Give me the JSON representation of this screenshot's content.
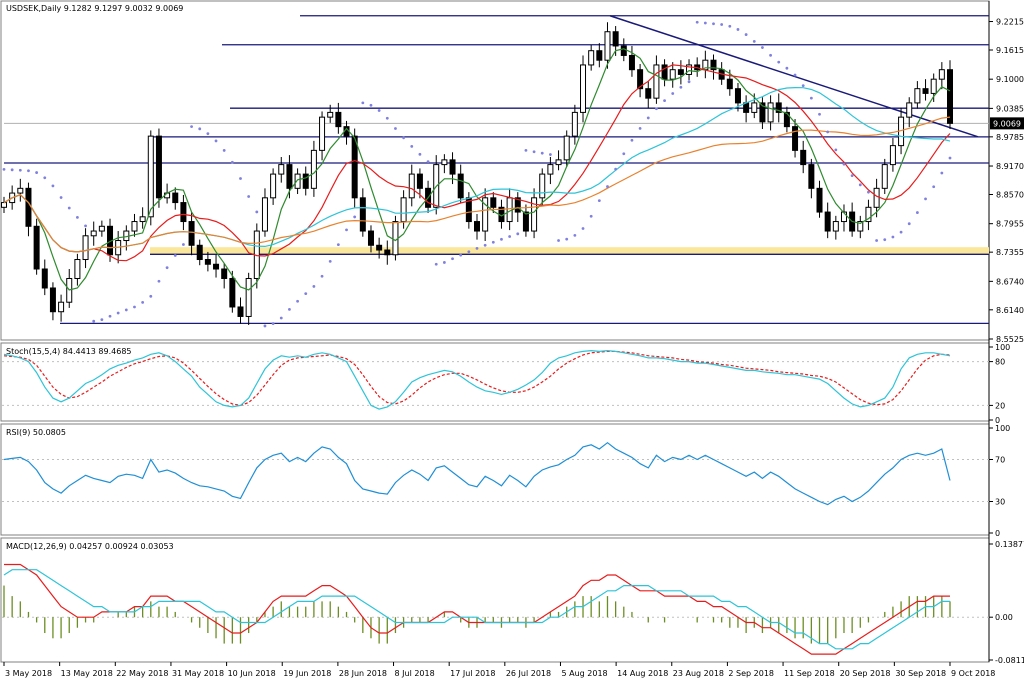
{
  "window": {
    "title": "USDSEK,Daily  9.1282 9.1297 9.0032 9.0069"
  },
  "colors": {
    "background": "#ffffff",
    "grid": "#c8c8c8",
    "candle": "#000000",
    "ma_fast": "#2e8b2e",
    "ma_mid": "#e81c1c",
    "ma_slow": "#2ec4d8",
    "ma_long": "#e8822e",
    "psar": "#8080e0",
    "hline": "#1a1a7a",
    "zone": "#fbe79a",
    "price_box": "#000000",
    "osc_main": "#1f8fd6",
    "osc_signal": "#e81c1c",
    "macd_hist": "#6b8e23"
  },
  "chart_data": [
    {
      "type": "candlestick",
      "symbol": "USDSEK",
      "timeframe": "Daily",
      "title": "USDSEK,Daily  9.1282 9.1297 9.0032 9.0069",
      "ohlc_last": {
        "open": 9.1282,
        "high": 9.1297,
        "low": 9.0032,
        "close": 9.0069
      },
      "current_price_label": "9.0069",
      "y_ticks": [
        "9.2215",
        "9.1615",
        "9.1000",
        "9.0385",
        "8.9785",
        "8.9170",
        "8.8570",
        "8.7955",
        "8.7355",
        "8.6740",
        "8.6140",
        "8.5525"
      ],
      "ylim": [
        8.5525,
        9.25
      ],
      "x_ticks": [
        "3 May 2018",
        "13 May 2018",
        "22 May 2018",
        "31 May 2018",
        "10 Jun 2018",
        "19 Jun 2018",
        "28 Jun 2018",
        "8 Jul 2018",
        "17 Jul 2018",
        "26 Jul 2018",
        "5 Aug 2018",
        "14 Aug 2018",
        "23 Aug 2018",
        "2 Sep 2018",
        "11 Sep 2018",
        "20 Sep 2018",
        "30 Sep 2018",
        "9 Oct 2018"
      ],
      "closes": [
        8.84,
        8.86,
        8.87,
        8.79,
        8.7,
        8.66,
        8.61,
        8.63,
        8.68,
        8.72,
        8.77,
        8.78,
        8.79,
        8.73,
        8.76,
        8.78,
        8.8,
        8.81,
        8.98,
        8.85,
        8.86,
        8.84,
        8.8,
        8.75,
        8.72,
        8.71,
        8.7,
        8.68,
        8.62,
        8.6,
        8.68,
        8.78,
        8.85,
        8.9,
        8.92,
        8.87,
        8.9,
        8.87,
        8.95,
        9.02,
        9.03,
        9.0,
        8.98,
        8.85,
        8.78,
        8.75,
        8.74,
        8.73,
        8.8,
        8.85,
        8.9,
        8.87,
        8.83,
        8.92,
        8.93,
        8.9,
        8.85,
        8.8,
        8.78,
        8.85,
        8.83,
        8.8,
        8.85,
        8.82,
        8.78,
        8.85,
        8.9,
        8.92,
        8.93,
        8.98,
        9.03,
        9.13,
        9.16,
        9.14,
        9.2,
        9.17,
        9.15,
        9.12,
        9.08,
        9.06,
        9.13,
        9.1,
        9.12,
        9.11,
        9.13,
        9.12,
        9.14,
        9.12,
        9.1,
        9.08,
        9.05,
        9.03,
        9.05,
        9.01,
        9.05,
        9.03,
        9.0,
        8.95,
        8.92,
        8.87,
        8.82,
        8.78,
        8.8,
        8.82,
        8.78,
        8.8,
        8.83,
        8.87,
        8.92,
        8.96,
        9.02,
        9.05,
        9.08,
        9.07,
        9.1,
        9.12,
        9.0069
      ],
      "horizontal_levels": [
        9.2337,
        9.1726,
        9.0389,
        8.9785,
        8.9233,
        8.731,
        8.5855
      ],
      "support_zone": [
        8.731,
        8.746
      ],
      "trendline": {
        "from": [
          9.2337
        ],
        "to": [
          8.9785
        ]
      }
    },
    {
      "type": "line",
      "title": "Stoch(15,5,4) 84.4413 89.4685",
      "y_ticks": [
        "100",
        "80",
        "20",
        "0"
      ],
      "ylim": [
        0,
        100
      ],
      "series": [
        {
          "name": "Stoch main",
          "values": [
            90,
            88,
            85,
            80,
            65,
            45,
            30,
            25,
            30,
            40,
            50,
            55,
            62,
            70,
            75,
            78,
            82,
            85,
            90,
            92,
            88,
            80,
            70,
            60,
            45,
            35,
            25,
            20,
            18,
            20,
            30,
            50,
            70,
            82,
            88,
            86,
            88,
            86,
            90,
            92,
            90,
            85,
            80,
            60,
            40,
            20,
            15,
            18,
            25,
            38,
            52,
            58,
            62,
            65,
            68,
            66,
            60,
            52,
            45,
            40,
            38,
            35,
            38,
            42,
            48,
            55,
            65,
            78,
            85,
            88,
            92,
            94,
            95,
            94,
            95,
            94,
            92,
            90,
            88,
            85,
            85,
            84,
            82,
            80,
            80,
            78,
            78,
            76,
            74,
            72,
            70,
            68,
            68,
            66,
            65,
            64,
            62,
            62,
            60,
            58,
            56,
            50,
            40,
            30,
            22,
            18,
            20,
            25,
            30,
            45,
            70,
            85,
            90,
            92,
            92,
            90,
            88
          ]
        },
        {
          "name": "Stoch signal",
          "values": [
            88,
            87,
            86,
            83,
            75,
            60,
            45,
            35,
            30,
            32,
            38,
            45,
            52,
            60,
            66,
            72,
            77,
            80,
            84,
            87,
            88,
            85,
            78,
            68,
            57,
            46,
            36,
            28,
            22,
            20,
            24,
            34,
            48,
            62,
            75,
            82,
            85,
            86,
            87,
            88,
            89,
            87,
            84,
            76,
            62,
            46,
            32,
            24,
            22,
            26,
            34,
            44,
            52,
            58,
            62,
            64,
            64,
            60,
            55,
            49,
            44,
            40,
            38,
            38,
            40,
            45,
            52,
            60,
            70,
            78,
            84,
            89,
            92,
            93,
            94,
            94,
            93,
            92,
            90,
            88,
            87,
            86,
            85,
            83,
            82,
            80,
            79,
            78,
            76,
            75,
            73,
            71,
            70,
            69,
            68,
            66,
            65,
            64,
            63,
            61,
            60,
            57,
            52,
            44,
            36,
            28,
            23,
            21,
            22,
            28,
            40,
            55,
            70,
            82,
            88,
            90,
            89
          ]
        }
      ]
    },
    {
      "type": "line",
      "title": "RSI(9) 50.0805",
      "y_ticks": [
        "100",
        "70",
        "30",
        "0"
      ],
      "ylim": [
        0,
        100
      ],
      "series": [
        {
          "name": "RSI",
          "values": [
            70,
            71,
            72,
            68,
            60,
            48,
            42,
            38,
            45,
            50,
            55,
            52,
            50,
            48,
            54,
            56,
            55,
            52,
            70,
            58,
            60,
            57,
            52,
            48,
            45,
            44,
            42,
            40,
            35,
            33,
            48,
            62,
            70,
            74,
            76,
            68,
            72,
            68,
            76,
            82,
            80,
            72,
            66,
            50,
            42,
            40,
            38,
            37,
            48,
            55,
            60,
            56,
            50,
            62,
            64,
            58,
            52,
            46,
            44,
            54,
            50,
            45,
            55,
            50,
            44,
            54,
            60,
            63,
            65,
            70,
            74,
            82,
            84,
            80,
            86,
            80,
            76,
            72,
            66,
            62,
            74,
            68,
            72,
            70,
            74,
            70,
            74,
            70,
            66,
            62,
            58,
            54,
            58,
            52,
            58,
            54,
            48,
            42,
            38,
            34,
            30,
            27,
            32,
            35,
            30,
            34,
            40,
            48,
            56,
            62,
            70,
            74,
            76,
            74,
            76,
            80,
            50
          ]
        }
      ]
    },
    {
      "type": "bar",
      "title": "MACD(12,26,9) 0.04257 0.00924 0.03053",
      "y_ticks": [
        "0.13877",
        "0.00",
        "-0.08114"
      ],
      "ylim": [
        -0.08114,
        0.13877
      ],
      "series": [
        {
          "name": "MACD histogram",
          "values": [
            0.06,
            0.04,
            0.03,
            0.01,
            -0.01,
            -0.03,
            -0.04,
            -0.04,
            -0.03,
            -0.02,
            -0.01,
            -0.01,
            0.0,
            0.0,
            0.01,
            0.01,
            0.02,
            0.02,
            0.03,
            0.02,
            0.02,
            0.01,
            0.0,
            -0.01,
            -0.02,
            -0.03,
            -0.04,
            -0.05,
            -0.05,
            -0.05,
            -0.03,
            -0.01,
            0.01,
            0.02,
            0.03,
            0.02,
            0.02,
            0.02,
            0.03,
            0.03,
            0.03,
            0.02,
            0.01,
            -0.01,
            -0.03,
            -0.04,
            -0.05,
            -0.05,
            -0.03,
            -0.02,
            -0.01,
            -0.01,
            -0.01,
            0.0,
            0.01,
            0.0,
            -0.01,
            -0.02,
            -0.02,
            -0.01,
            -0.01,
            -0.02,
            -0.01,
            -0.01,
            -0.02,
            -0.01,
            0.0,
            0.01,
            0.01,
            0.02,
            0.03,
            0.04,
            0.04,
            0.03,
            0.04,
            0.03,
            0.02,
            0.01,
            0.0,
            -0.01,
            0.0,
            -0.01,
            0.0,
            0.0,
            0.0,
            -0.01,
            0.0,
            -0.01,
            -0.01,
            -0.02,
            -0.02,
            -0.03,
            -0.02,
            -0.03,
            -0.02,
            -0.03,
            -0.03,
            -0.04,
            -0.04,
            -0.05,
            -0.05,
            -0.05,
            -0.04,
            -0.03,
            -0.03,
            -0.02,
            -0.01,
            0.0,
            0.01,
            0.02,
            0.03,
            0.04,
            0.04,
            0.04,
            0.04,
            0.04,
            0.03
          ]
        },
        {
          "name": "MACD",
          "values": [
            0.1,
            0.1,
            0.1,
            0.09,
            0.08,
            0.06,
            0.04,
            0.02,
            0.01,
            0.0,
            0.0,
            0.0,
            0.01,
            0.01,
            0.01,
            0.01,
            0.02,
            0.02,
            0.04,
            0.04,
            0.04,
            0.03,
            0.03,
            0.02,
            0.01,
            0.0,
            -0.01,
            -0.02,
            -0.03,
            -0.03,
            -0.02,
            -0.01,
            0.01,
            0.03,
            0.04,
            0.04,
            0.04,
            0.04,
            0.05,
            0.06,
            0.06,
            0.05,
            0.04,
            0.02,
            0.0,
            -0.02,
            -0.03,
            -0.03,
            -0.02,
            -0.01,
            -0.01,
            -0.01,
            -0.01,
            0.0,
            0.01,
            0.01,
            0.0,
            -0.01,
            -0.01,
            -0.01,
            -0.01,
            -0.01,
            -0.01,
            -0.01,
            -0.01,
            -0.01,
            0.0,
            0.01,
            0.02,
            0.03,
            0.04,
            0.06,
            0.07,
            0.07,
            0.08,
            0.08,
            0.07,
            0.06,
            0.05,
            0.05,
            0.05,
            0.04,
            0.04,
            0.04,
            0.04,
            0.03,
            0.03,
            0.02,
            0.02,
            0.01,
            0.0,
            -0.01,
            -0.01,
            -0.02,
            -0.02,
            -0.03,
            -0.04,
            -0.05,
            -0.06,
            -0.07,
            -0.07,
            -0.07,
            -0.07,
            -0.06,
            -0.05,
            -0.04,
            -0.03,
            -0.02,
            -0.01,
            0.0,
            0.01,
            0.02,
            0.03,
            0.03,
            0.04,
            0.04,
            0.04
          ]
        },
        {
          "name": "Signal",
          "values": [
            0.08,
            0.09,
            0.09,
            0.09,
            0.09,
            0.08,
            0.07,
            0.06,
            0.05,
            0.04,
            0.03,
            0.02,
            0.02,
            0.01,
            0.01,
            0.01,
            0.01,
            0.02,
            0.02,
            0.03,
            0.03,
            0.03,
            0.03,
            0.03,
            0.03,
            0.02,
            0.01,
            0.01,
            0.0,
            -0.01,
            -0.01,
            -0.01,
            -0.01,
            0.0,
            0.01,
            0.02,
            0.03,
            0.03,
            0.03,
            0.04,
            0.04,
            0.04,
            0.04,
            0.04,
            0.03,
            0.02,
            0.01,
            0.0,
            -0.01,
            -0.01,
            -0.01,
            -0.01,
            -0.01,
            -0.01,
            -0.01,
            0.0,
            0.0,
            0.0,
            0.0,
            -0.01,
            -0.01,
            -0.01,
            -0.01,
            -0.01,
            -0.01,
            -0.01,
            -0.01,
            0.0,
            0.0,
            0.01,
            0.02,
            0.02,
            0.03,
            0.04,
            0.05,
            0.05,
            0.06,
            0.06,
            0.06,
            0.06,
            0.05,
            0.05,
            0.05,
            0.05,
            0.04,
            0.04,
            0.04,
            0.04,
            0.03,
            0.03,
            0.02,
            0.02,
            0.01,
            0.0,
            -0.01,
            -0.01,
            -0.02,
            -0.03,
            -0.03,
            -0.04,
            -0.05,
            -0.05,
            -0.06,
            -0.06,
            -0.06,
            -0.05,
            -0.05,
            -0.04,
            -0.03,
            -0.02,
            -0.01,
            0.0,
            0.01,
            0.02,
            0.02,
            0.03,
            0.03
          ]
        }
      ]
    }
  ],
  "panels": {
    "main_header": "USDSEK,Daily  9.1282 9.1297 9.0032 9.0069",
    "stoch_header": "Stoch(15,5,4) 84.4413 89.4685",
    "rsi_header": "RSI(9) 50.0805",
    "macd_header": "MACD(12,26,9) 0.04257 0.00924 0.03053"
  }
}
